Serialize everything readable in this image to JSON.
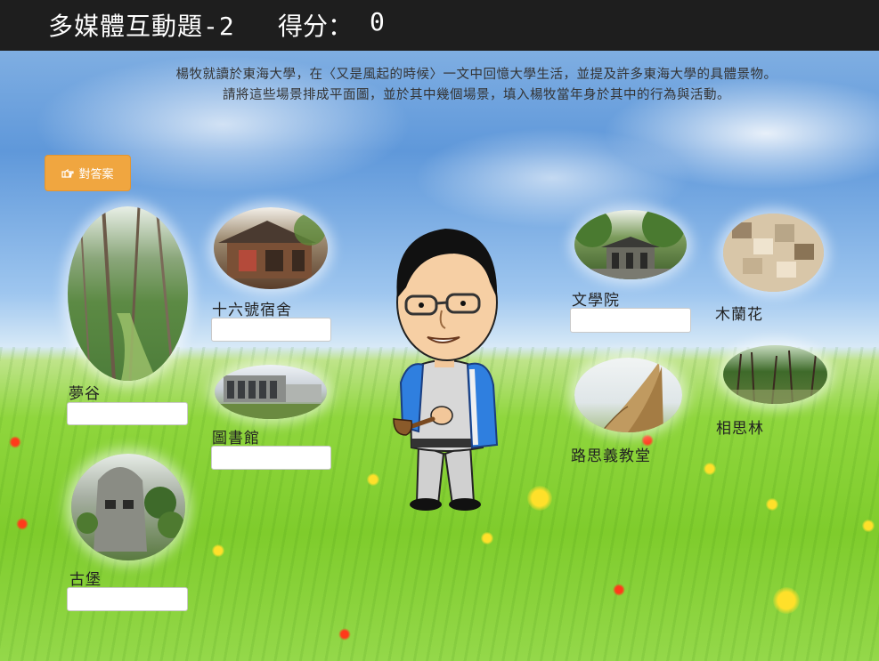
{
  "header": {
    "title": "多媒體互動題-2",
    "score_label": "得分：",
    "score_value": "0"
  },
  "instructions": {
    "line1": "楊牧就讀於東海大學，在〈又是風起的時候〉一文中回憶大學生活，並提及許多東海大學的具體景物。",
    "line2": "請將這些場景排成平面圖，並於其中幾個場景，填入楊牧當年身於其中的行為與活動。"
  },
  "answer_button": {
    "label": "對答案",
    "icon": "hand-point-right-icon"
  },
  "places": {
    "menggu": {
      "label": "夢谷",
      "value": ""
    },
    "dorm16": {
      "label": "十六號宿舍",
      "value": ""
    },
    "library": {
      "label": "圖書館",
      "value": ""
    },
    "castle": {
      "label": "古堡",
      "value": ""
    },
    "arts": {
      "label": "文學院",
      "value": ""
    },
    "magnolia": {
      "label": "木蘭花"
    },
    "chapel": {
      "label": "路思義教堂"
    },
    "acacia": {
      "label": "相思林"
    }
  },
  "colors": {
    "header_bg": "#1e1e1e",
    "button_bg": "#f0a640",
    "sky": "#5f98da",
    "grass": "#7fcc2c"
  }
}
